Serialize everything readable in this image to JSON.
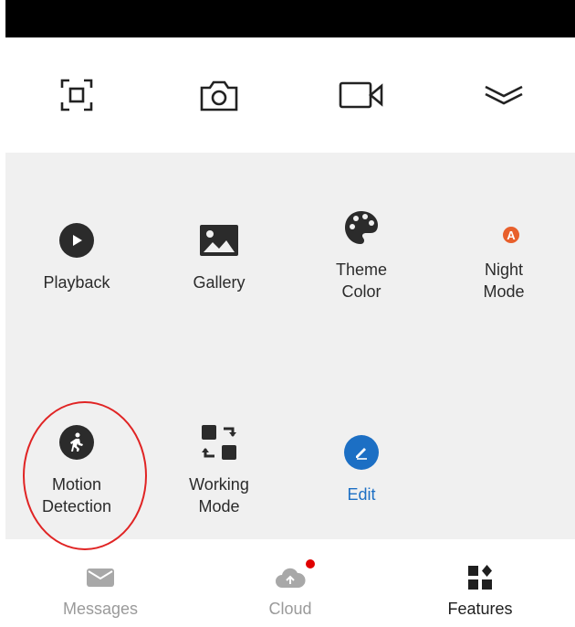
{
  "colors": {
    "accent": "#1c6fc4",
    "night_mode": "#e8602c",
    "notification_dot": "#e00000",
    "annotation": "#e02424",
    "icon_dark": "#2b2b2b"
  },
  "toolbar": {
    "items": [
      {
        "icon": "screenshot-frame-icon"
      },
      {
        "icon": "camera-icon"
      },
      {
        "icon": "video-camera-icon"
      },
      {
        "icon": "collapse-chevron-icon"
      }
    ]
  },
  "features": {
    "items": [
      {
        "label": "Playback",
        "icon": "play-circle-icon"
      },
      {
        "label": "Gallery",
        "icon": "image-icon"
      },
      {
        "label": "Theme\nColor",
        "icon": "palette-icon"
      },
      {
        "label": "Night\nMode",
        "icon": "night-mode-icon"
      },
      {
        "label": "Motion\nDetection",
        "icon": "walking-person-icon"
      },
      {
        "label": "Working\nMode",
        "icon": "switch-mode-icon"
      },
      {
        "label": "Edit",
        "icon": "pencil-icon"
      }
    ]
  },
  "nav": {
    "items": [
      {
        "label": "Messages",
        "icon": "message-icon",
        "active": false
      },
      {
        "label": "Cloud",
        "icon": "cloud-icon",
        "active": false,
        "badge": true
      },
      {
        "label": "Features",
        "icon": "features-grid-icon",
        "active": true
      }
    ]
  }
}
